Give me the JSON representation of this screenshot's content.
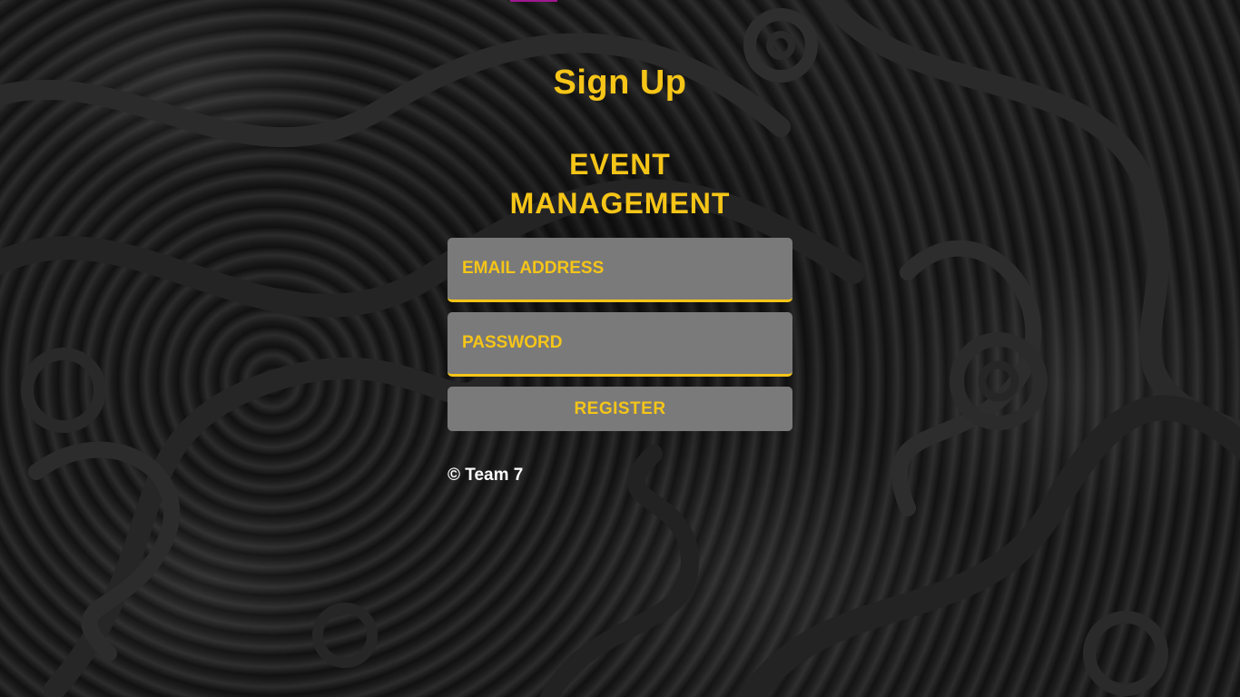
{
  "page": {
    "title": "Sign Up",
    "app_name_line1": "EVENT",
    "app_name_line2": "MANAGEMENT"
  },
  "form": {
    "email_placeholder": "EMAIL ADDRESS",
    "password_placeholder": "PASSWORD",
    "email_value": "",
    "password_value": "",
    "register_label": "REGISTER"
  },
  "footer": {
    "copyright": "© Team 7"
  },
  "colors": {
    "accent": "#f5c518",
    "field_background": "#7a7a7a",
    "background": "#161616",
    "footer_text": "#ffffff",
    "top_accent": "#a0168f"
  }
}
